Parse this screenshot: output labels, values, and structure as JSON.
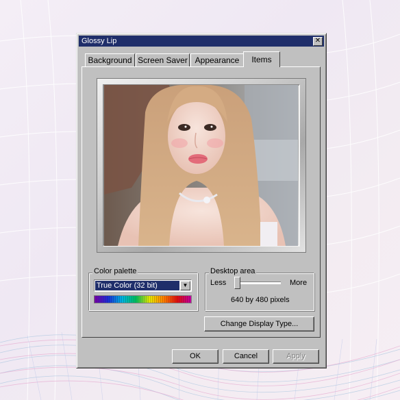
{
  "window": {
    "title": "Glossy Lip",
    "close_glyph": "✕"
  },
  "tabs": [
    {
      "label": "Background",
      "active": false
    },
    {
      "label": "Screen Saver",
      "active": false
    },
    {
      "label": "Appearance",
      "active": false
    },
    {
      "label": "Items",
      "active": true
    }
  ],
  "preview": {
    "image": "selfie-photo"
  },
  "color_palette": {
    "label": "Color palette",
    "selected": "True Color (32 bit)"
  },
  "desktop_area": {
    "label": "Desktop area",
    "less_label": "Less",
    "more_label": "More",
    "value_text": "640 by 480 pixels",
    "slider_level": 0
  },
  "buttons": {
    "change_display_type": "Change Display Type...",
    "ok": "OK",
    "cancel": "Cancel",
    "apply": "Apply"
  },
  "colors": {
    "titlebar": "#1f2e6a",
    "window_face": "#c0c0c0"
  }
}
